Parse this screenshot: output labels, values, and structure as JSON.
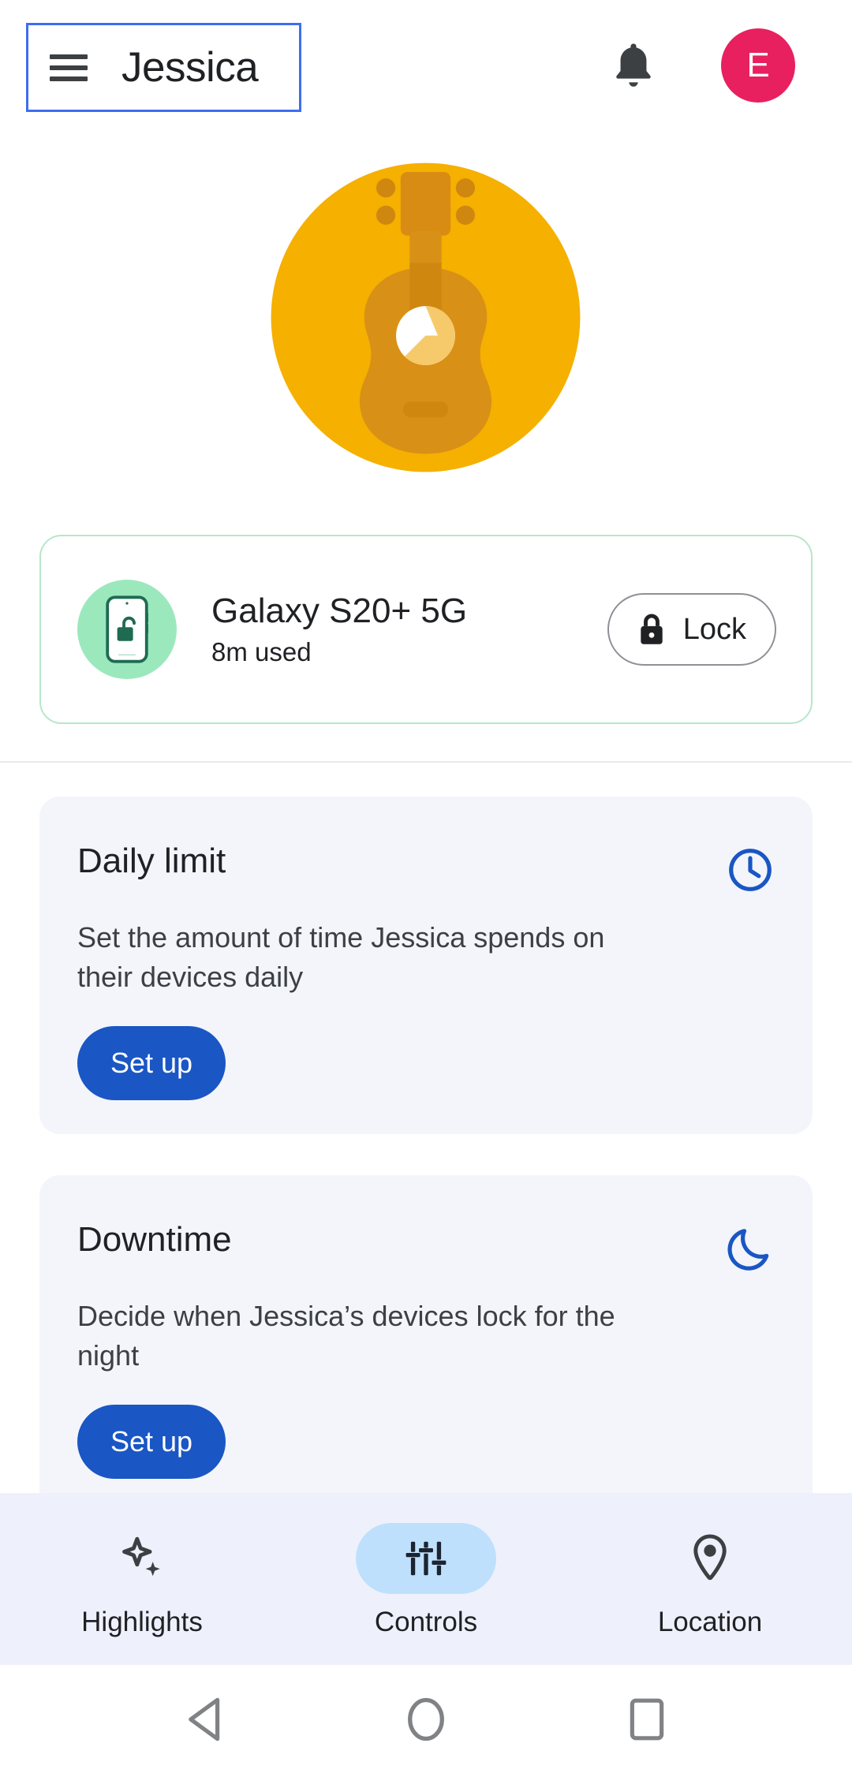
{
  "header": {
    "menu_icon": "hamburger-menu-icon",
    "title": "Jessica",
    "notifications_icon": "bell-icon",
    "account_initial": "E",
    "focus_outline_color": "#3d6ef0",
    "avatar_color": "#e8205f"
  },
  "child_avatar": {
    "icon": "guitar-avatar-icon",
    "circle_color": "#F5B000",
    "guitar_body_color": "#D99016",
    "guitar_neck_color": "#D88C14",
    "soundhole_color": "#FFFFFF",
    "soundhole_shade_color": "#F6C96A"
  },
  "device_card": {
    "status_icon": "phone-unlocked-icon",
    "status_circle_color": "#9ce8bd",
    "border_color": "#b6e7c9",
    "name": "Galaxy S20+ 5G",
    "usage": "8m used",
    "lock_button": {
      "icon": "lock-closed-icon",
      "label": "Lock"
    }
  },
  "cards": [
    {
      "id": "daily-limit",
      "title": "Daily limit",
      "icon": "clock-icon",
      "icon_color": "#1a56c4",
      "description": "Set the amount of time Jessica spends on their devices daily",
      "button_label": "Set up",
      "button_color": "#1a56c4"
    },
    {
      "id": "downtime",
      "title": "Downtime",
      "icon": "moon-icon",
      "icon_color": "#1a56c4",
      "description": "Decide when Jessica’s devices lock for the night",
      "button_label": "Set up",
      "button_color": "#1a56c4"
    }
  ],
  "bottom_nav": {
    "background": "#eef1fb",
    "active_pill_color": "#bfe0fc",
    "items": [
      {
        "label": "Highlights",
        "icon": "sparkle-icon",
        "active": false
      },
      {
        "label": "Controls",
        "icon": "sliders-icon",
        "active": true
      },
      {
        "label": "Location",
        "icon": "location-pin-icon",
        "active": false
      }
    ]
  },
  "system_nav": {
    "items": [
      {
        "icon": "back-triangle-icon"
      },
      {
        "icon": "home-circle-icon"
      },
      {
        "icon": "recents-square-icon"
      }
    ],
    "color": "#808285"
  }
}
